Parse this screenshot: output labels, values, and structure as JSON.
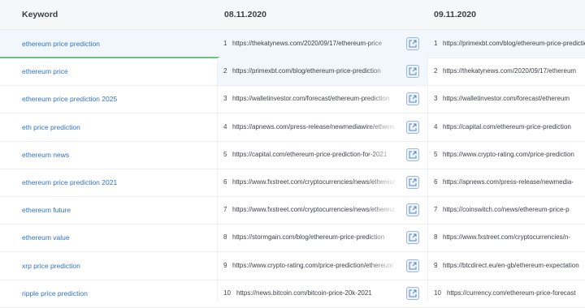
{
  "header": {
    "keyword_label": "Keyword",
    "date1": "08.11.2020",
    "date2": "09.11.2020"
  },
  "rows": [
    {
      "keyword": "ethereum price prediction",
      "r1": "1",
      "u1": "https://thekatynews.com/2020/09/17/ethereum-price",
      "r2": "1",
      "u2": "https://primexbt.com/blog/ethereum-price-prediction"
    },
    {
      "keyword": "ethereum price",
      "r1": "2",
      "u1": "https://primexbt.com/blog/ethereum-price-prediction",
      "r2": "2",
      "u2": "https://thekatynews.com/2020/09/17/ethereum"
    },
    {
      "keyword": "ethereum price prediction 2025",
      "r1": "3",
      "u1": "https://walletinvestor.com/forecast/ethereum-prediction",
      "r2": "3",
      "u2": "https://walletinvestor.com/forecast/ethereum"
    },
    {
      "keyword": "eth price prediction",
      "r1": "4",
      "u1": "https://apnews.com/press-release/newmediawire/ethereum",
      "r2": "4",
      "u2": "https://capital.com/ethereum-price-prediction"
    },
    {
      "keyword": "ethereum news",
      "r1": "5",
      "u1": "https://capital.com/ethereum-price-prediction-for-2021",
      "r2": "5",
      "u2": "https://www.crypto-rating.com/price-prediction"
    },
    {
      "keyword": "ethereum price prediction 2021",
      "r1": "6",
      "u1": "https://www.fxstreet.com/cryptocurrencies/news/ethereum",
      "r2": "6",
      "u2": "https://apnews.com/press-release/newmedia-"
    },
    {
      "keyword": "ethereum future",
      "r1": "7",
      "u1": "https://www.fxstreet.com/cryptocurrencies/news/ethereum",
      "r2": "7",
      "u2": "https://coinswitch.co/news/ethereum-price-p"
    },
    {
      "keyword": "ethereum value",
      "r1": "8",
      "u1": "https://stormgain.com/blog/ethereum-price-prediction",
      "r2": "8",
      "u2": "https://www.fxstreet.com/cryptocurrencies/n-"
    },
    {
      "keyword": "xrp price prediction",
      "r1": "9",
      "u1": "https://www.crypto-rating.com/price-prediction/ethereum",
      "r2": "9",
      "u2": "https://btcdirect.eu/en-gb/ethereum-expectation"
    },
    {
      "keyword": "ripple price prediction",
      "r1": "10",
      "u1": "https://news.bitcoin.com/bitcoin-price-20k-2021",
      "r2": "10",
      "u2": "https://currency.com/ethereum-price-forecast"
    }
  ],
  "icons": {
    "open_link": "external-link-icon"
  },
  "colors": {
    "link": "#2f72c4",
    "selected_row": "#f2f7fd",
    "accent_green": "#65c37c"
  }
}
